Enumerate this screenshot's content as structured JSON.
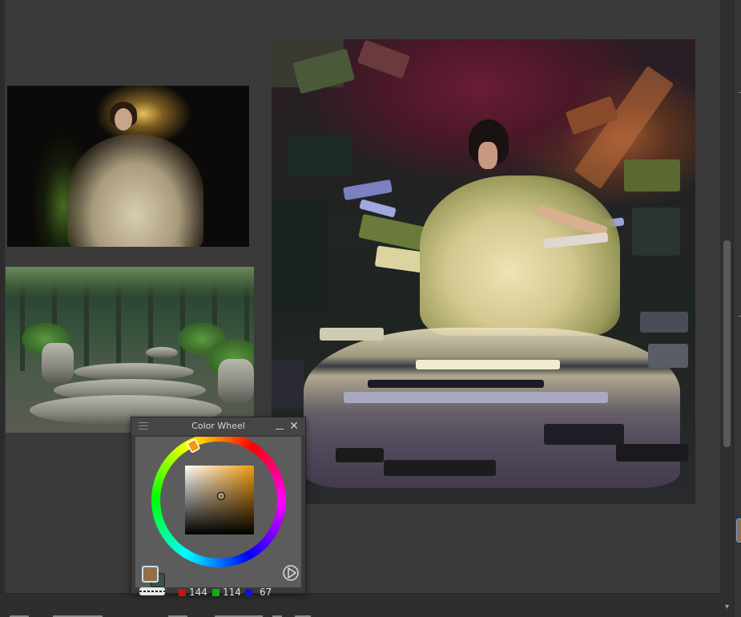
{
  "docker": {
    "title": "Color Wheel",
    "close_glyph": "✕"
  },
  "colors": {
    "foreground": "#907048",
    "background": "#3a524a",
    "hue_square": "#f09a10",
    "red_chip": "#d01010",
    "green_chip": "#10b010",
    "blue_chip": "#1010e0"
  },
  "rgb": {
    "r": "144",
    "g": "114",
    "b": "67"
  },
  "icons": {
    "menu": "hamburger-icon",
    "minimize": "minimize-icon",
    "close": "close-icon",
    "play": "play-circle-icon",
    "scroll_down": "chevron-down-icon"
  },
  "scroll": {
    "down_glyph": "▾"
  }
}
